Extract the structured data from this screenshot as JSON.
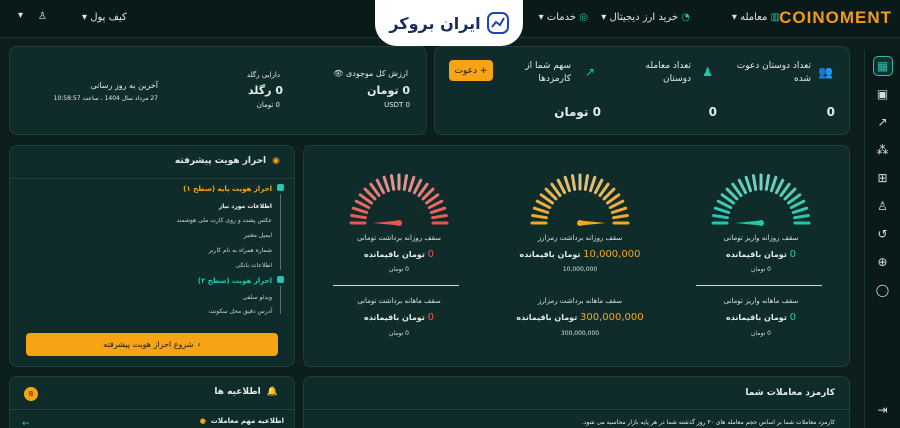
{
  "topbar": {
    "logo": "COINOMENT",
    "nav": {
      "trade": "معامله",
      "buy_digital": "خرید ارز دیجیتال",
      "services": "خدمات"
    },
    "brand": "ایران بروکر",
    "wallet": "کیف پول"
  },
  "stats": {
    "invited_title": "تعداد دوستان دعوت شده",
    "invited_value": "0",
    "friends_trades_title": "تعداد معامله دوستان",
    "friends_trades_value": "0",
    "commission_title": "سهم شما از کارمزدها",
    "commission_value": "0 تومان",
    "invite_button": "دعوت +"
  },
  "assets": {
    "total_label": "ارزش کل موجودی",
    "toman_value": "0 تومان",
    "usdt_value": "USDT 0",
    "rgold_label": "دارایی رگلد",
    "rgold_value": "0 رگلد",
    "rgold_sub": "0 تومان",
    "last_update_label": "آخرین به روز رسانی",
    "last_update_value": "27 مرداد سال 1404 ، ساعت 10:58:57"
  },
  "kyc": {
    "title": "احراز هویت پیشرفته",
    "level1": "احراز هویت پایه (سطح ۱)",
    "level1_items": [
      "اطلاعات مورد نیاز",
      "عکس پشت و روی کارت ملی هوشمند",
      "ایمیل معتبر",
      "شماره همراه به نام کاربر",
      "اطلاعات بانکی"
    ],
    "level2": "احراز هویت (سطح ۲)",
    "level2_items": [
      "ویدئو سلفی",
      "آدرس دقیق محل سکونت"
    ],
    "start_button": "شروع احراز هویت پیشرفته"
  },
  "limits": {
    "gauges": [
      {
        "label": "سقف روزانه واریز تومانی",
        "value": "0",
        "unit": "تومان باقیمانده",
        "total": "0 تومان",
        "color": "#22c7ad",
        "level": 0.0
      },
      {
        "label": "سقف روزانه برداشت رمزارز",
        "value": "10,000,000",
        "unit": "تومان باقیمانده",
        "total": "10,000,000",
        "color": "#f5a623",
        "level": 1.0
      },
      {
        "label": "سقف روزانه برداشت تومانی",
        "value": "0",
        "unit": "تومان باقیمانده",
        "total": "0 تومان",
        "color": "#ef5350",
        "level": 0.0
      }
    ],
    "monthly": [
      {
        "label": "سقف ماهانه واریز تومانی",
        "value": "0",
        "unit": "تومان باقیمانده",
        "total": "0 تومان",
        "color": "#22c7ad"
      },
      {
        "label": "سقف ماهانه برداشت رمزارز",
        "value": "300,000,000",
        "unit": "تومان باقیمانده",
        "total": "300,000,000",
        "color": "#f5a623"
      },
      {
        "label": "سقف ماهانه برداشت تومانی",
        "value": "0",
        "unit": "تومان باقیمانده",
        "total": "0 تومان",
        "color": "#ef5350"
      }
    ]
  },
  "notifications": {
    "title": "اطلاعیه ها",
    "count": "8",
    "item": "اطلاعیه مهم معاملات"
  },
  "commission_panel": {
    "title": "کارمزد معاملات شما",
    "text": "کارمزد معاملات شما بر اساس حجم معامله های ۳۰ روز گذشته شما در هر پایه بازار محاسبه می شود."
  },
  "colors": {
    "accent": "#22c7ad",
    "orange": "#f6a316",
    "red": "#ef5350"
  }
}
